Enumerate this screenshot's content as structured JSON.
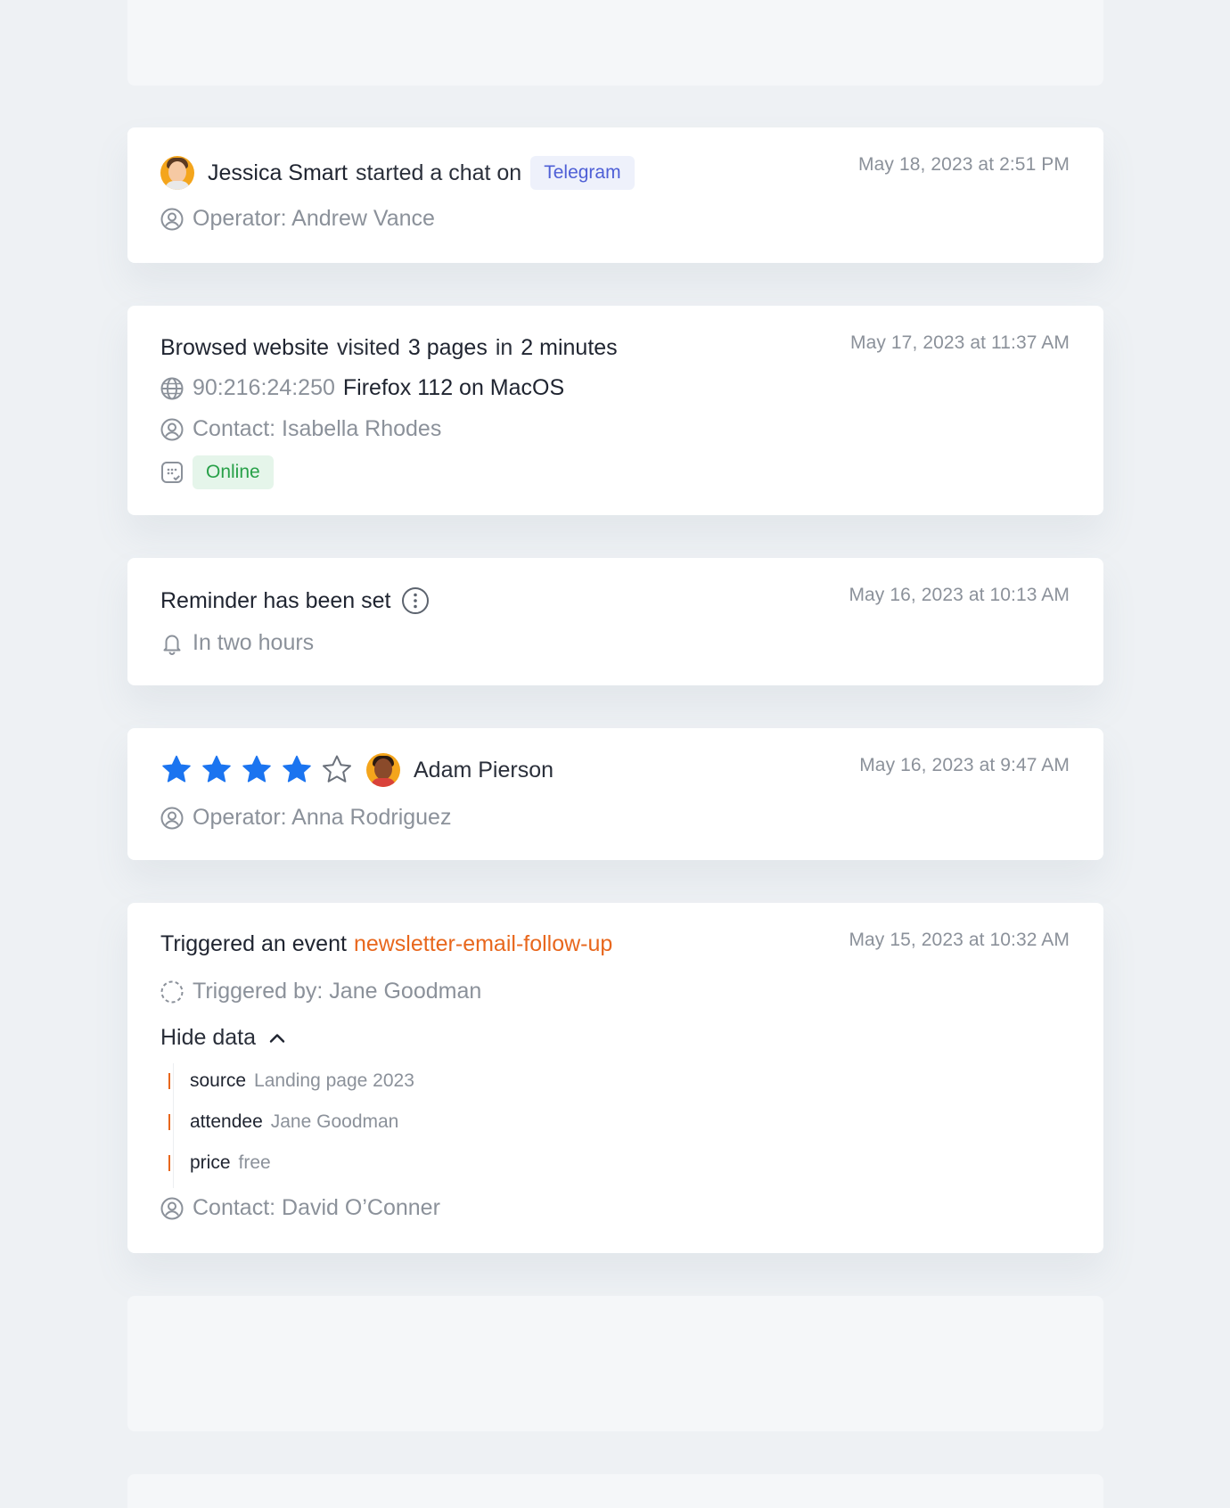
{
  "colors": {
    "page_bg": "#eef1f4",
    "card_bg": "#ffffff",
    "muted_text": "#8b919a",
    "strong_text": "#1f2430",
    "telegram_badge": "#4e5fd6",
    "online_badge": "#27a048",
    "event_accent": "#e8671d",
    "star_filled": "#1b74f0"
  },
  "cards": {
    "chat": {
      "person": "Jessica Smart",
      "action": "started a chat on",
      "channel": "Telegram",
      "operator": "Operator: Andrew Vance",
      "timestamp": "May 18, 2023 at 2:51 PM"
    },
    "browse": {
      "title": "Browsed website",
      "visited": "visited",
      "pages": "3 pages",
      "in": "in",
      "duration": "2 minutes",
      "ip": "90:216:24:250",
      "browser": "Firefox 112 on MacOS",
      "contact": "Contact: Isabella Rhodes",
      "status": "Online",
      "timestamp": "May 17, 2023 at 11:37 AM"
    },
    "reminder": {
      "title": "Reminder has been set",
      "when": "In two hours",
      "timestamp": "May 16, 2023 at 10:13 AM"
    },
    "rating": {
      "stars": 4,
      "max_stars": 5,
      "person": "Adam Pierson",
      "operator": "Operator: Anna Rodriguez",
      "timestamp": "May 16, 2023 at 9:47 AM"
    },
    "event": {
      "title": "Triggered an event",
      "event_name": "newsletter-email-follow-up",
      "triggered_by": "Triggered by: Jane Goodman",
      "toggle_label": "Hide data",
      "data": [
        {
          "key": "source",
          "value": "Landing page 2023"
        },
        {
          "key": "attendee",
          "value": "Jane Goodman"
        },
        {
          "key": "price",
          "value": "free"
        }
      ],
      "contact": "Contact: David O’Conner",
      "timestamp": "May 15, 2023 at 10:32 AM"
    }
  },
  "icons": [
    "user-circle-icon",
    "globe-icon",
    "device-status-icon",
    "info-icon",
    "bell-icon",
    "dashed-circle-icon",
    "chevron-up-icon",
    "star-filled-icon",
    "star-outline-icon"
  ]
}
